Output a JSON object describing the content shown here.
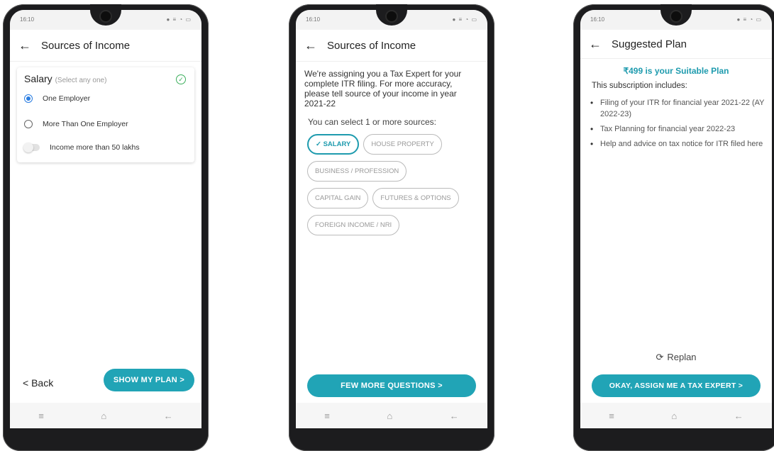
{
  "status": {
    "time": "16:10",
    "signal": "…",
    "icons": "● ≡ ◔ ▭"
  },
  "nav": {
    "menu": "≡",
    "home": "⌂",
    "back": "←"
  },
  "screen1": {
    "title": "Sources of Income",
    "card_title": "Salary",
    "card_sub": "(Select any one)",
    "options": [
      "One Employer",
      "More Than One Employer"
    ],
    "toggle_label": "Income more than 50 lakhs",
    "back_label": "< Back",
    "cta": "SHOW MY PLAN >"
  },
  "screen2": {
    "title": "Sources of Income",
    "paragraph": "We're assigning you a Tax Expert for your complete ITR filing. For more accuracy, please tell source of your income in year 2021-22",
    "subhead": "You can select 1 or more sources:",
    "chips": [
      "✓ SALARY",
      "HOUSE PROPERTY",
      "BUSINESS / PROFESSION",
      "CAPITAL GAIN",
      "FUTURES & OPTIONS",
      "FOREIGN INCOME / NRI"
    ],
    "cta": "FEW MORE QUESTIONS >"
  },
  "screen3": {
    "title": "Suggested Plan",
    "price": "₹499  is your Suitable Plan",
    "includes": "This subscription includes:",
    "bullets": [
      "Filing of your ITR for financial year 2021-22 (AY 2022-23)",
      "Tax Planning for financial year 2022-23",
      "Help and advice on tax notice for ITR filed here"
    ],
    "replan": "Replan",
    "cta": "OKAY, ASSIGN ME A TAX EXPERT >"
  },
  "colors": {
    "accent": "#21a4b6",
    "radio": "#2a7de1",
    "check": "#3aae5b"
  }
}
